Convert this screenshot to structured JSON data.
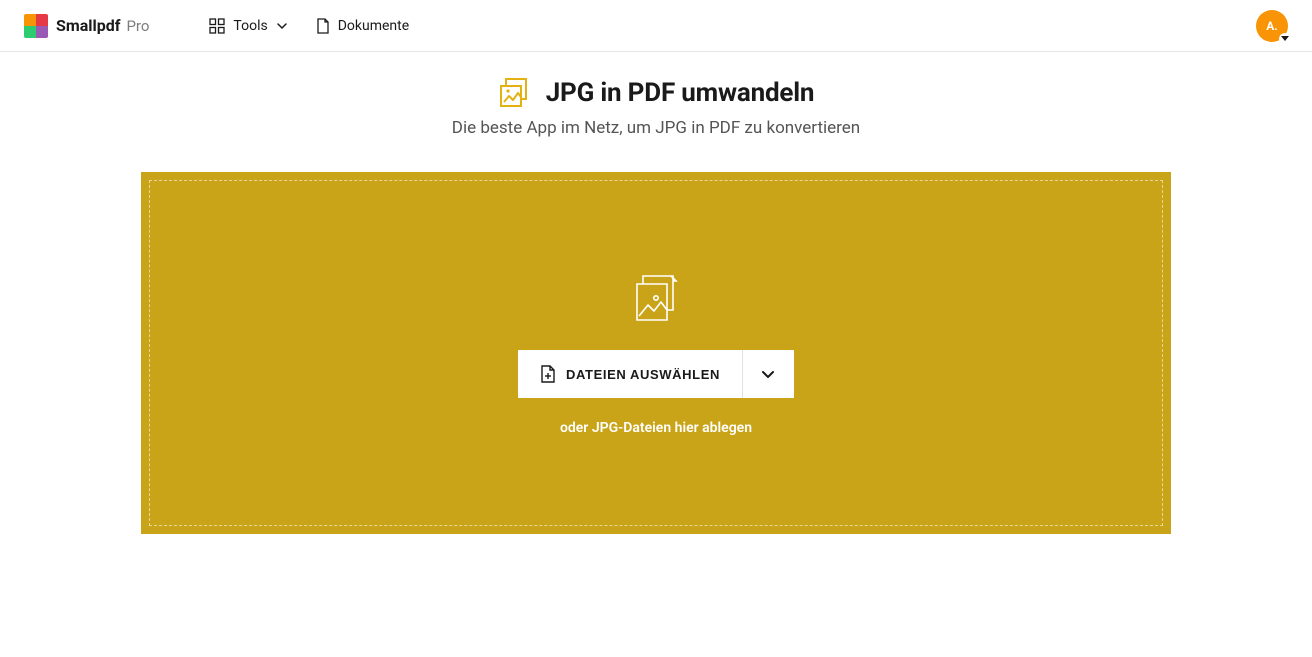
{
  "header": {
    "brand": "Smallpdf",
    "brand_suffix": "Pro",
    "nav": {
      "tools_label": "Tools",
      "documents_label": "Dokumente"
    },
    "avatar_initial": "A."
  },
  "page": {
    "title": "JPG in PDF umwandeln",
    "subtitle": "Die beste App im Netz, um JPG in PDF zu konvertieren"
  },
  "dropzone": {
    "button_label": "DATEIEN AUSWÄHLEN",
    "hint": "oder JPG-Dateien hier ablegen"
  },
  "colors": {
    "accent": "#caa418",
    "brand_orange": "#f89406"
  }
}
